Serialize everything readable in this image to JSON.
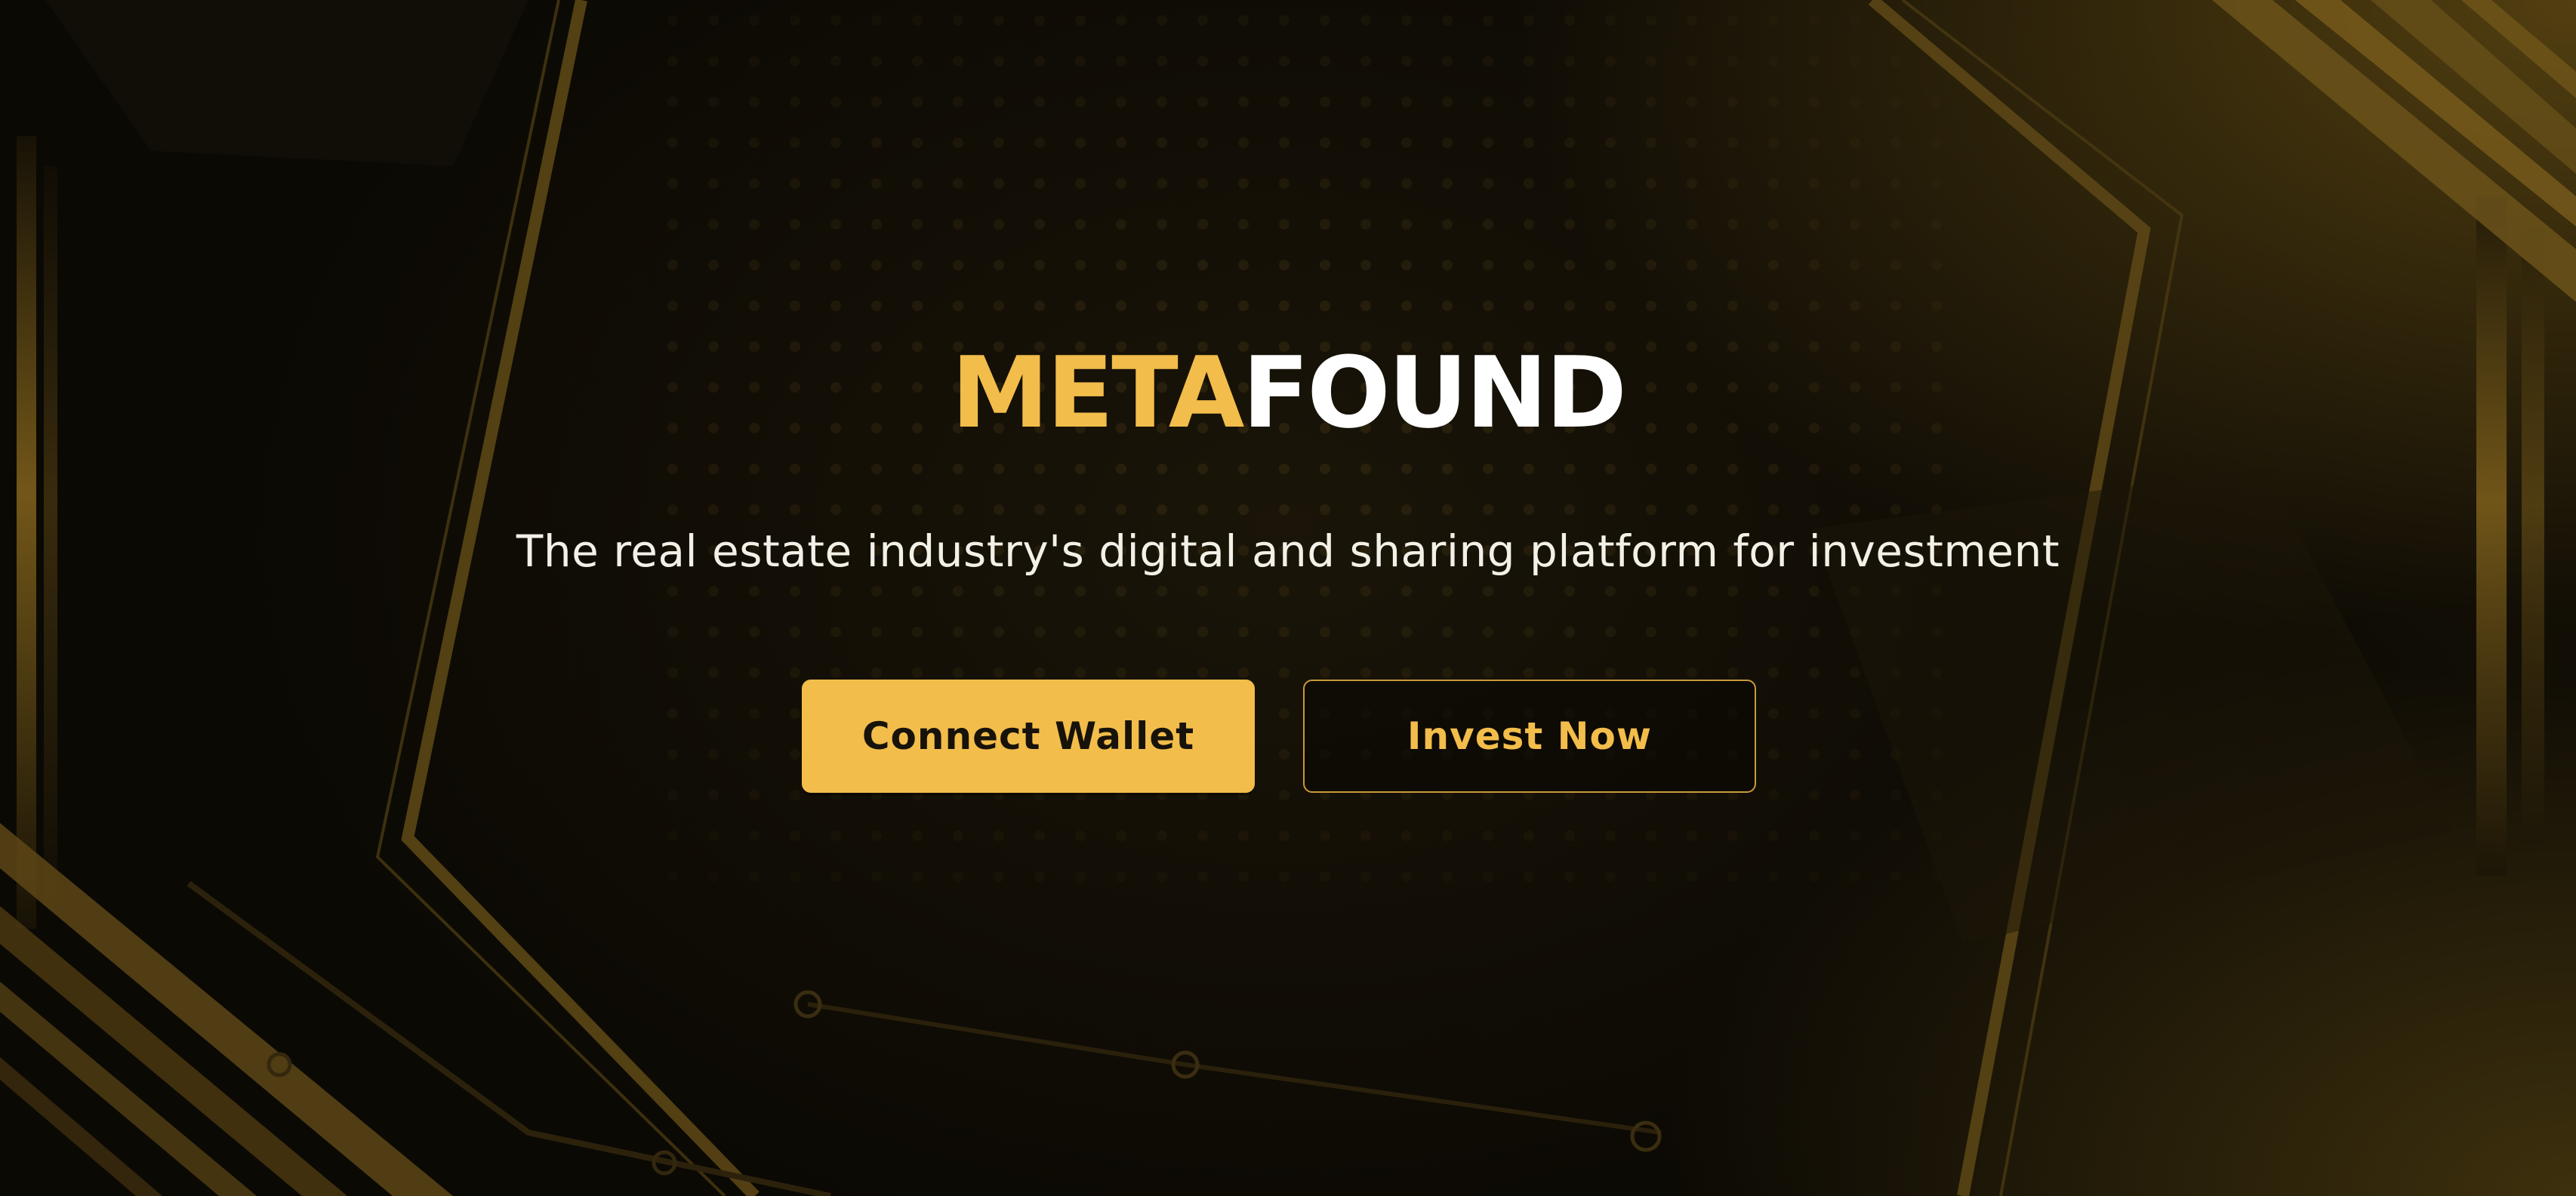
{
  "brand": {
    "part1": "META",
    "part2": "FOUND"
  },
  "tagline": "The real estate industry's digital and sharing platform for investment",
  "buttons": {
    "connect_wallet": "Connect Wallet",
    "invest_now": "Invest Now"
  },
  "colors": {
    "accent": "#f2bd4a",
    "background": "#0e0b05",
    "text": "#ffffff",
    "button_text_dark": "#17130a"
  }
}
